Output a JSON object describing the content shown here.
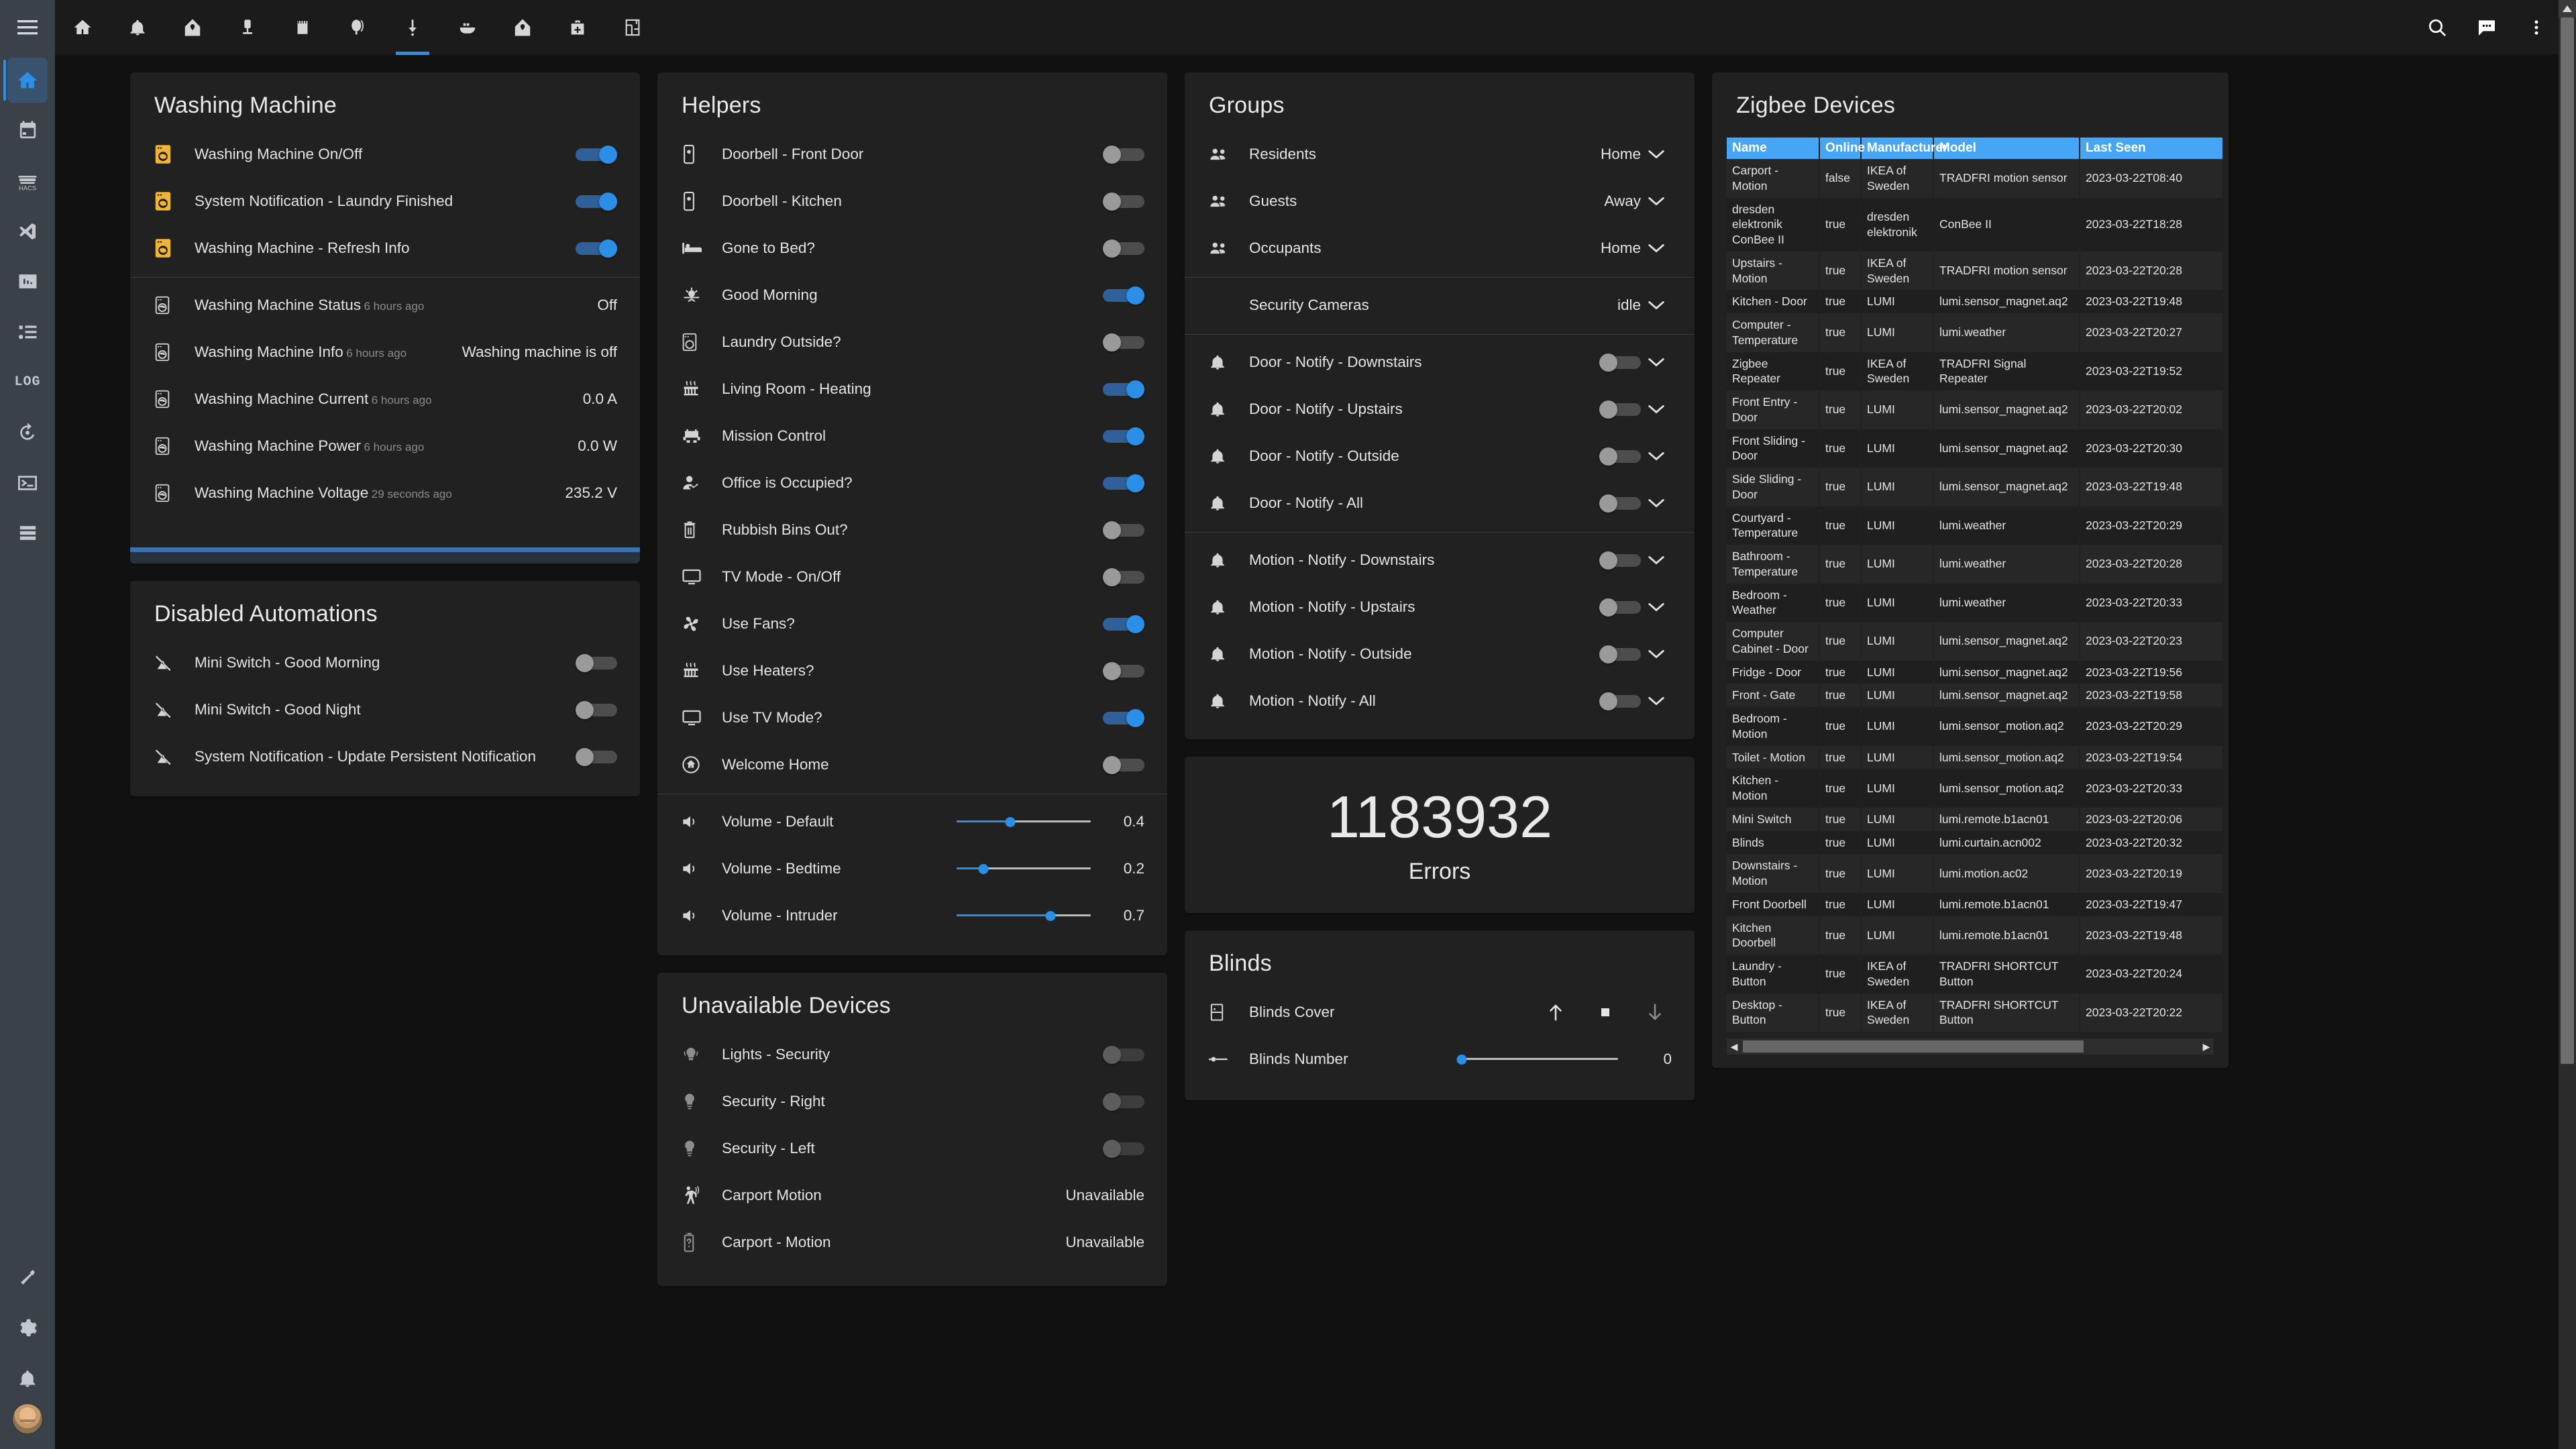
{
  "sidebar": {
    "menu_icon": "hamburger-icon",
    "items": [
      {
        "icon": "home-icon",
        "name": "home",
        "active": true
      },
      {
        "icon": "calendar-icon",
        "name": "calendar",
        "active": false
      },
      {
        "icon": "hacs-icon",
        "name": "hacs",
        "active": false,
        "label": "HACS"
      },
      {
        "icon": "vscode-icon",
        "name": "vscode",
        "active": false
      },
      {
        "icon": "chart-box-icon",
        "name": "statistics",
        "active": false
      },
      {
        "icon": "list-icon",
        "name": "list",
        "active": false
      },
      {
        "icon": "log-icon",
        "name": "log",
        "active": false,
        "label": "LOG"
      },
      {
        "icon": "history-icon",
        "name": "history",
        "active": false
      },
      {
        "icon": "terminal-icon",
        "name": "terminal",
        "active": false
      },
      {
        "icon": "server-icon",
        "name": "server",
        "active": false
      }
    ],
    "bottom_items": [
      {
        "icon": "hammer-icon",
        "name": "developer-tools"
      },
      {
        "icon": "gear-icon",
        "name": "settings"
      },
      {
        "icon": "bell-icon",
        "name": "notifications"
      }
    ],
    "avatar": "user-avatar"
  },
  "topbar": {
    "tabs": [
      {
        "icon": "home-icon",
        "name": "tab-home",
        "active": false
      },
      {
        "icon": "bell-icon",
        "name": "tab-alerts",
        "active": false
      },
      {
        "icon": "home-heart-icon",
        "name": "tab-house",
        "active": false
      },
      {
        "icon": "lamp-icon",
        "name": "tab-lights",
        "active": false
      },
      {
        "icon": "book-icon",
        "name": "tab-notes",
        "active": false
      },
      {
        "icon": "balloon-icon",
        "name": "tab-balloon",
        "active": false
      },
      {
        "icon": "download-icon",
        "name": "tab-downloads",
        "active": true
      },
      {
        "icon": "docker-icon",
        "name": "tab-docker",
        "active": false
      },
      {
        "icon": "home-heart-icon",
        "name": "tab-house-2",
        "active": false
      },
      {
        "icon": "briefcase-plus-icon",
        "name": "tab-add",
        "active": false
      },
      {
        "icon": "floorplan-icon",
        "name": "tab-floorplan",
        "active": false
      }
    ],
    "actions": [
      {
        "icon": "search-icon",
        "name": "search-button"
      },
      {
        "icon": "assist-icon",
        "name": "assist-button"
      },
      {
        "icon": "overflow-menu-icon",
        "name": "overflow-menu-button"
      }
    ]
  },
  "colors": {
    "accent": "#2b8fe8",
    "amber": "#f1b434",
    "table_header": "#46a6f5",
    "card_bg": "#212121",
    "page_bg": "#111111"
  },
  "cards": {
    "washing_machine": {
      "title": "Washing Machine",
      "switches": [
        {
          "icon": "washing-machine-icon",
          "label": "Washing Machine On/Off",
          "on": true
        },
        {
          "icon": "washing-machine-icon",
          "label": "System Notification - Laundry Finished",
          "on": true
        },
        {
          "icon": "washing-machine-icon",
          "label": "Washing Machine - Refresh Info",
          "on": true
        }
      ],
      "sensors": [
        {
          "icon": "washing-machine-icon",
          "label": "Washing Machine Status",
          "sub": "6 hours ago",
          "value": "Off"
        },
        {
          "icon": "washing-machine-icon",
          "label": "Washing Machine Info",
          "sub": "6 hours ago",
          "value": "Washing machine is off"
        },
        {
          "icon": "washing-machine-icon",
          "label": "Washing Machine Current",
          "sub": "6 hours ago",
          "value": "0.0 A"
        },
        {
          "icon": "washing-machine-icon",
          "label": "Washing Machine Power",
          "sub": "6 hours ago",
          "value": "0.0 W"
        },
        {
          "icon": "washing-machine-icon",
          "label": "Washing Machine Voltage",
          "sub": "29 seconds ago",
          "value": "235.2 V"
        }
      ],
      "progress_percent": 100
    },
    "disabled_automations": {
      "title": "Disabled Automations",
      "items": [
        {
          "icon": "robot-off-icon",
          "label": "Mini Switch - Good Morning",
          "on": false
        },
        {
          "icon": "robot-off-icon",
          "label": "Mini Switch - Good Night",
          "on": false
        },
        {
          "icon": "robot-off-icon",
          "label": "System Notification - Update Persistent Notification",
          "on": false
        }
      ]
    },
    "helpers": {
      "title": "Helpers",
      "toggles": [
        {
          "icon": "doorbell-icon",
          "label": "Doorbell - Front Door",
          "on": false
        },
        {
          "icon": "doorbell-icon",
          "label": "Doorbell - Kitchen",
          "on": false
        },
        {
          "icon": "bed-icon",
          "label": "Gone to Bed?",
          "on": false
        },
        {
          "icon": "sunrise-icon",
          "label": "Good Morning",
          "on": true
        },
        {
          "icon": "washing-machine-icon",
          "label": "Laundry Outside?",
          "on": false
        },
        {
          "icon": "radiator-icon",
          "label": "Living Room - Heating",
          "on": true
        },
        {
          "icon": "space-invader-icon",
          "label": "Mission Control",
          "on": true
        },
        {
          "icon": "account-check-icon",
          "label": "Office is Occupied?",
          "on": true
        },
        {
          "icon": "trash-icon",
          "label": "Rubbish Bins Out?",
          "on": false
        },
        {
          "icon": "monitor-icon",
          "label": "TV Mode - On/Off",
          "on": false
        },
        {
          "icon": "fan-icon",
          "label": "Use Fans?",
          "on": true
        },
        {
          "icon": "radiator-icon",
          "label": "Use Heaters?",
          "on": false
        },
        {
          "icon": "monitor-icon",
          "label": "Use TV Mode?",
          "on": true
        },
        {
          "icon": "home-circle-icon",
          "label": "Welcome Home",
          "on": false
        }
      ],
      "sliders": [
        {
          "icon": "volume-icon",
          "label": "Volume - Default",
          "value": "0.4",
          "percent": 40
        },
        {
          "icon": "volume-icon",
          "label": "Volume - Bedtime",
          "value": "0.2",
          "percent": 20
        },
        {
          "icon": "volume-icon",
          "label": "Volume - Intruder",
          "value": "0.7",
          "percent": 70
        }
      ]
    },
    "unavailable_devices": {
      "title": "Unavailable Devices",
      "items": [
        {
          "icon": "light-group-icon",
          "label": "Lights - Security",
          "kind": "toggle",
          "on": false
        },
        {
          "icon": "bulb-icon",
          "label": "Security - Right",
          "kind": "toggle",
          "on": false
        },
        {
          "icon": "bulb-icon",
          "label": "Security - Left",
          "kind": "toggle",
          "on": false
        },
        {
          "icon": "motion-sensor-icon",
          "label": "Carport Motion",
          "kind": "value",
          "value": "Unavailable"
        },
        {
          "icon": "battery-unknown-icon",
          "label": "Carport - Motion",
          "kind": "value",
          "value": "Unavailable"
        }
      ]
    },
    "groups": {
      "title": "Groups",
      "people": [
        {
          "icon": "people-icon",
          "label": "Residents",
          "state": "Home"
        },
        {
          "icon": "people-icon",
          "label": "Guests",
          "state": "Away"
        },
        {
          "icon": "people-icon",
          "label": "Occupants",
          "state": "Home"
        }
      ],
      "cameras": [
        {
          "icon": "",
          "label": "Security Cameras",
          "state": "idle"
        }
      ],
      "door_notify": [
        {
          "icon": "bell-icon",
          "label": "Door - Notify - Downstairs",
          "on": false
        },
        {
          "icon": "bell-icon",
          "label": "Door - Notify - Upstairs",
          "on": false
        },
        {
          "icon": "bell-icon",
          "label": "Door - Notify - Outside",
          "on": false
        },
        {
          "icon": "bell-icon",
          "label": "Door - Notify - All",
          "on": false
        }
      ],
      "motion_notify": [
        {
          "icon": "bell-icon",
          "label": "Motion - Notify - Downstairs",
          "on": false
        },
        {
          "icon": "bell-icon",
          "label": "Motion - Notify - Upstairs",
          "on": false
        },
        {
          "icon": "bell-icon",
          "label": "Motion - Notify - Outside",
          "on": false
        },
        {
          "icon": "bell-icon",
          "label": "Motion - Notify - All",
          "on": false
        }
      ]
    },
    "errors": {
      "value": "1183932",
      "label": "Errors"
    },
    "blinds": {
      "title": "Blinds",
      "cover": {
        "icon": "blinds-icon",
        "label": "Blinds Cover",
        "buttons": [
          {
            "icon": "arrow-up-icon",
            "name": "blinds-open-button",
            "dim": false
          },
          {
            "icon": "stop-square-icon",
            "name": "blinds-stop-button",
            "dim": false
          },
          {
            "icon": "arrow-down-icon",
            "name": "blinds-close-button",
            "dim": true
          }
        ]
      },
      "number": {
        "icon": "ray-start-icon",
        "label": "Blinds Number",
        "value": "0",
        "percent": 0
      }
    },
    "zigbee": {
      "title": "Zigbee Devices",
      "columns": [
        "Name",
        "Online",
        "Manufacturer",
        "Model",
        "Last Seen"
      ],
      "rows": [
        [
          "Carport - Motion",
          "false",
          "IKEA of Sweden",
          "TRADFRI motion sensor",
          "2023-03-22T08:40"
        ],
        [
          "dresden elektronik ConBee II",
          "true",
          "dresden elektronik",
          "ConBee II",
          "2023-03-22T18:28"
        ],
        [
          "Upstairs - Motion",
          "true",
          "IKEA of Sweden",
          "TRADFRI motion sensor",
          "2023-03-22T20:28"
        ],
        [
          "Kitchen - Door",
          "true",
          "LUMI",
          "lumi.sensor_magnet.aq2",
          "2023-03-22T19:48"
        ],
        [
          "Computer - Temperature",
          "true",
          "LUMI",
          "lumi.weather",
          "2023-03-22T20:27"
        ],
        [
          "Zigbee Repeater",
          "true",
          "IKEA of Sweden",
          "TRADFRI Signal Repeater",
          "2023-03-22T19:52"
        ],
        [
          "Front Entry - Door",
          "true",
          "LUMI",
          "lumi.sensor_magnet.aq2",
          "2023-03-22T20:02"
        ],
        [
          "Front Sliding - Door",
          "true",
          "LUMI",
          "lumi.sensor_magnet.aq2",
          "2023-03-22T20:30"
        ],
        [
          "Side Sliding - Door",
          "true",
          "LUMI",
          "lumi.sensor_magnet.aq2",
          "2023-03-22T19:48"
        ],
        [
          "Courtyard - Temperature",
          "true",
          "LUMI",
          "lumi.weather",
          "2023-03-22T20:29"
        ],
        [
          "Bathroom - Temperature",
          "true",
          "LUMI",
          "lumi.weather",
          "2023-03-22T20:28"
        ],
        [
          "Bedroom - Weather",
          "true",
          "LUMI",
          "lumi.weather",
          "2023-03-22T20:33"
        ],
        [
          "Computer Cabinet - Door",
          "true",
          "LUMI",
          "lumi.sensor_magnet.aq2",
          "2023-03-22T20:23"
        ],
        [
          "Fridge - Door",
          "true",
          "LUMI",
          "lumi.sensor_magnet.aq2",
          "2023-03-22T19:56"
        ],
        [
          "Front - Gate",
          "true",
          "LUMI",
          "lumi.sensor_magnet.aq2",
          "2023-03-22T19:58"
        ],
        [
          "Bedroom - Motion",
          "true",
          "LUMI",
          "lumi.sensor_motion.aq2",
          "2023-03-22T20:29"
        ],
        [
          "Toilet - Motion",
          "true",
          "LUMI",
          "lumi.sensor_motion.aq2",
          "2023-03-22T19:54"
        ],
        [
          "Kitchen - Motion",
          "true",
          "LUMI",
          "lumi.sensor_motion.aq2",
          "2023-03-22T20:33"
        ],
        [
          "Mini Switch",
          "true",
          "LUMI",
          "lumi.remote.b1acn01",
          "2023-03-22T20:06"
        ],
        [
          "Blinds",
          "true",
          "LUMI",
          "lumi.curtain.acn002",
          "2023-03-22T20:32"
        ],
        [
          "Downstairs - Motion",
          "true",
          "LUMI",
          "lumi.motion.ac02",
          "2023-03-22T20:19"
        ],
        [
          "Front Doorbell",
          "true",
          "LUMI",
          "lumi.remote.b1acn01",
          "2023-03-22T19:47"
        ],
        [
          "Kitchen Doorbell",
          "true",
          "LUMI",
          "lumi.remote.b1acn01",
          "2023-03-22T19:48"
        ],
        [
          "Laundry - Button",
          "true",
          "IKEA of Sweden",
          "TRADFRI SHORTCUT Button",
          "2023-03-22T20:24"
        ],
        [
          "Desktop - Button",
          "true",
          "IKEA of Sweden",
          "TRADFRI SHORTCUT Button",
          "2023-03-22T20:22"
        ]
      ]
    }
  }
}
